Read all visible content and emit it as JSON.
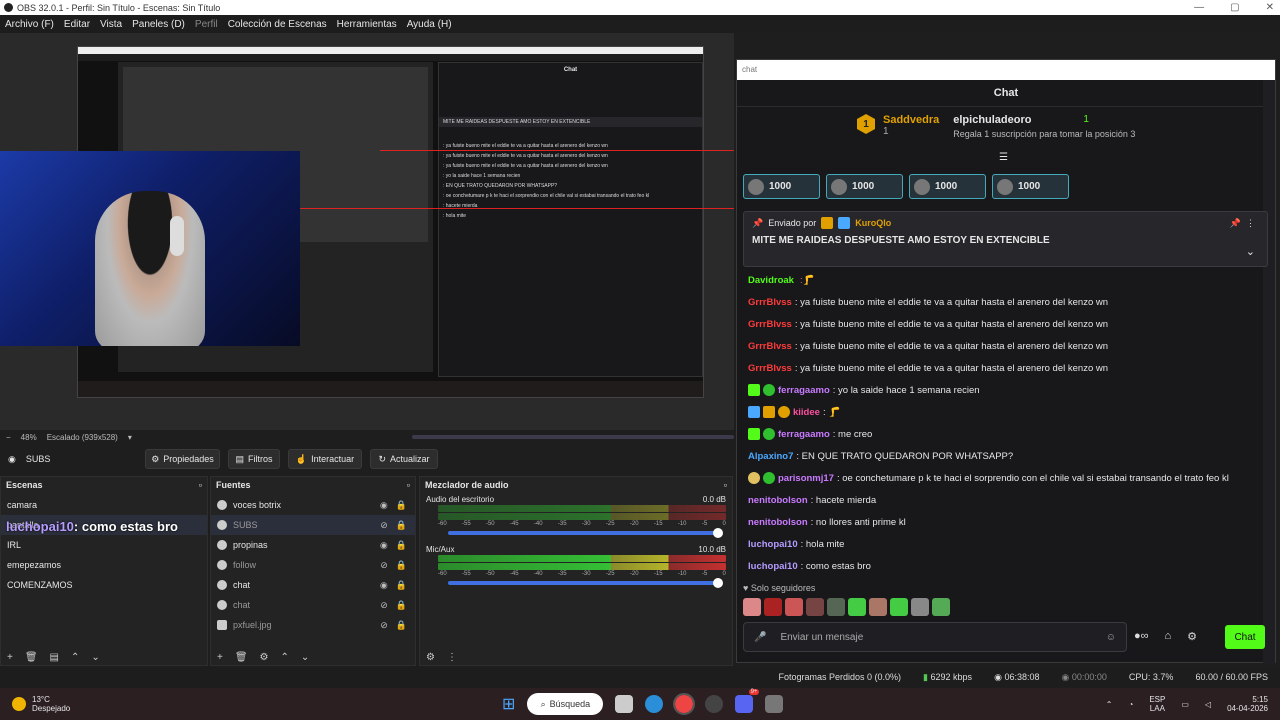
{
  "window": {
    "title": "OBS 32.0.1 - Perfil: Sin Título - Escenas: Sin Título",
    "min": "—",
    "max": "▢",
    "close": "✕"
  },
  "menu": {
    "items": [
      "Archivo (F)",
      "Editar",
      "Vista",
      "Paneles (D)",
      "Perfil",
      "Colección de Escenas",
      "Herramientas",
      "Ayuda (H)"
    ]
  },
  "preview": {
    "zoom": "48%",
    "scale": "Escalado (939x528)"
  },
  "source_bar": {
    "name": "SUBS",
    "properties": "Propiedades",
    "filters": "Filtros",
    "interact": "Interactuar",
    "refresh": "Actualizar"
  },
  "scenes": {
    "title": "Escenas",
    "items": [
      "camara",
      "pantalla",
      "IRL",
      "emepezamos",
      "COMENZAMOS"
    ]
  },
  "overlay": {
    "user": "luchopai10",
    "text": ": como estas bro"
  },
  "sources": {
    "title": "Fuentes",
    "items": [
      "voces botrix",
      "SUBS",
      "propinas",
      "follow",
      "chat",
      "chat",
      "pxfuel.jpg"
    ]
  },
  "mixer": {
    "title": "Mezclador de audio",
    "channels": [
      {
        "name": "Audio del escritorio",
        "db": "0.0 dB"
      },
      {
        "name": "Mic/Aux",
        "db": "10.0 dB"
      }
    ],
    "scale": [
      "-60",
      "-55",
      "-50",
      "-45",
      "-40",
      "-35",
      "-30",
      "-25",
      "-20",
      "-15",
      "-10",
      "-5",
      "0"
    ]
  },
  "chat": {
    "window_label": "chat",
    "title": "Chat",
    "leader": {
      "rank": "1",
      "name": "Saddvedra",
      "count": "1",
      "user2": "elpichuladeoro",
      "count2": "1",
      "desc": "Regala 1 suscripción para tomar la posición 3"
    },
    "gifts": [
      "1000",
      "1000",
      "1000",
      "1000"
    ],
    "pinned": {
      "header": "Enviado por",
      "by": "KuroQlo",
      "message": "MITE ME RAIDEAS DESPUESTE AMO ESTOY EN EXTENCIBLE"
    },
    "messages": [
      {
        "user": "Davidroak",
        "color": "#53fc18",
        "text": ""
      },
      {
        "user": "GrrrBlvss",
        "color": "#ff3b3b",
        "text": ": ya fuiste bueno mite el eddie te va a quitar hasta el arenero del kenzo wn"
      },
      {
        "user": "GrrrBlvss",
        "color": "#ff3b3b",
        "text": ": ya fuiste bueno mite el eddie te va a quitar hasta el arenero del kenzo wn"
      },
      {
        "user": "GrrrBlvss",
        "color": "#ff3b3b",
        "text": ": ya fuiste bueno mite el eddie te va a quitar hasta el arenero del kenzo wn"
      },
      {
        "user": "GrrrBlvss",
        "color": "#ff3b3b",
        "text": ": ya fuiste bueno mite el eddie te va a quitar hasta el arenero del kenzo wn"
      },
      {
        "user": "ferragaamo",
        "color": "#c97bff",
        "text": ": yo la saide hace 1 semana recien"
      },
      {
        "user": "kiidee",
        "color": "#ff4fa0",
        "text": ":"
      },
      {
        "user": "ferragaamo",
        "color": "#c97bff",
        "text": ": me creo"
      },
      {
        "user": "Alpaxino7",
        "color": "#4aa8ff",
        "text": ": EN QUE TRATO QUEDARON POR WHATSAPP?"
      },
      {
        "user": "parisonmj17",
        "color": "#c97bff",
        "text": ": oe conchetumare p k te haci el sorprendio con el chile val si estabai transando el trato feo kl"
      },
      {
        "user": "nenitobolson",
        "color": "#c97bff",
        "text": ": hacete mierda"
      },
      {
        "user": "nenitobolson",
        "color": "#c97bff",
        "text": ": no llores anti prime kl"
      },
      {
        "user": "luchopai10",
        "color": "#b69cff",
        "text": ": hola mite"
      },
      {
        "user": "luchopai10",
        "color": "#b69cff",
        "text": ": como estas bro"
      }
    ],
    "followers_only": "Solo seguidores",
    "input_placeholder": "Enviar un mensaje",
    "send": "Chat"
  },
  "status": {
    "dropped": "Fotogramas Perdidos 0 (0.0%)",
    "kbps": "6292 kbps",
    "live": "06:38:08",
    "rec": "00:00:00",
    "cpu": "CPU: 3.7%",
    "fps": "60.00 / 60.00 FPS"
  },
  "taskbar": {
    "temp": "13°C",
    "weather": "Despejado",
    "search": "Búsqueda",
    "lang1": "ESP",
    "lang2": "LAA",
    "time": "5:15",
    "date": "04-04-2026",
    "discord_badge": "9+"
  },
  "colors": {
    "kick_green": "#53fc18",
    "obs_bg": "#1e1e1e",
    "chat_bg": "#18181b",
    "taskbar": "#2b1f22"
  }
}
